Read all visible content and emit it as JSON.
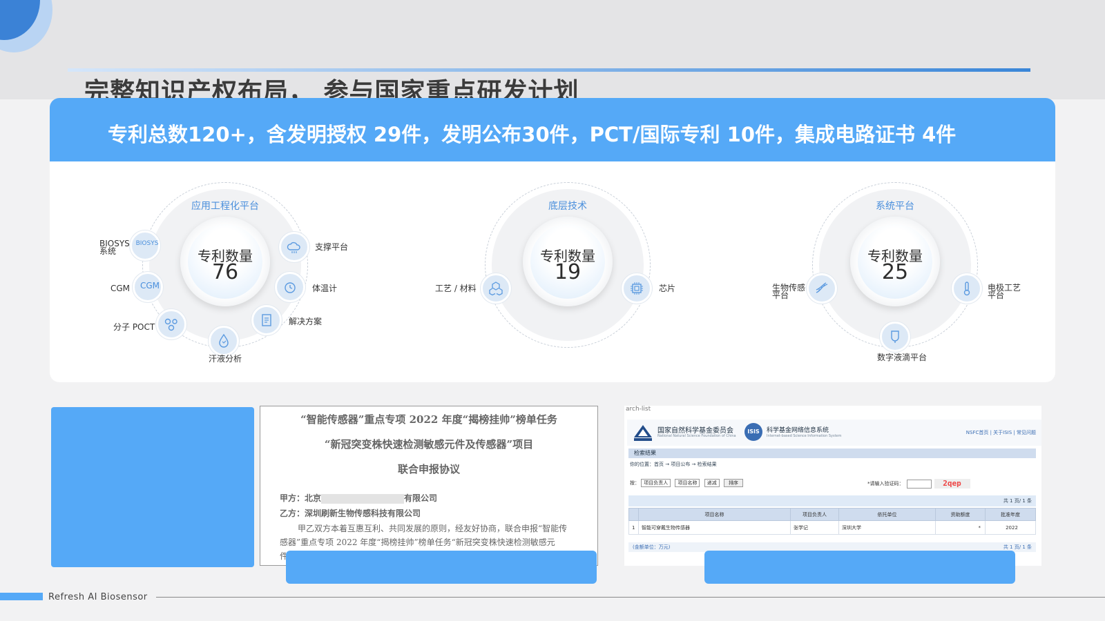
{
  "page": {
    "title": "完整知识产权布局， 参与国家重点研发计划",
    "banner": "专利总数120+，含发明授权 29件，发明公布30件，PCT/国际专利 10件，集成电路证书 4件",
    "footer": "Refresh AI Biosensor"
  },
  "clusters": [
    {
      "title": "应用工程化平台",
      "core_label": "专利数量",
      "core_value": "76",
      "nodes": [
        {
          "label": "BIOSYS系统",
          "icon_text": "BIOSYS",
          "icon": "biosys-logo-icon"
        },
        {
          "label": "CGM",
          "icon_text": "CGM",
          "icon": "cgm-logo-icon"
        },
        {
          "label": "分子 POCT",
          "icon": "molecule-icon"
        },
        {
          "label": "汗液分析",
          "icon": "droplet-icon"
        },
        {
          "label": "解决方案",
          "icon": "document-icon"
        },
        {
          "label": "体温计",
          "icon": "clock-icon"
        },
        {
          "label": "支撑平台",
          "icon": "cloud-icon"
        }
      ]
    },
    {
      "title": "底层技术",
      "core_label": "专利数量",
      "core_value": "19",
      "nodes": [
        {
          "label": "工艺 / 材料",
          "icon": "cubes-icon"
        },
        {
          "label": "芯片",
          "icon": "chip-icon"
        }
      ]
    },
    {
      "title": "系统平台",
      "core_label": "专利数量",
      "core_value": "25",
      "nodes": [
        {
          "label": "生物传感平台",
          "icon": "dna-icon"
        },
        {
          "label": "电极工艺平台",
          "icon": "thermometer-icon"
        },
        {
          "label": "数字液滴平台",
          "icon": "test-tube-icon"
        }
      ]
    }
  ],
  "agreement": {
    "line1": "“智能传感器”重点专项 2022 年度“揭榜挂帅”榜单任务",
    "line2": "“新冠突变株快速检测敏感元件及传感器”项目",
    "line3": "联合申报协议",
    "party_a_prefix": "甲方：北京",
    "party_a_suffix": "有限公司",
    "party_b": "乙方：深圳刷新生物传感科技有限公司",
    "body1": "甲乙双方本着互惠互利、共同发展的原则，经友好协商，联合申报“智能传",
    "body2": "感器”重点专项 2022 年度“揭榜挂帅”榜单任务“新冠突变株快速检测敏感元",
    "body3": "件"
  },
  "nsfc": {
    "tab": "arch-list",
    "org_name": "国家自然科学基金委员会",
    "org_name_en": "National Natural Science Foundation of China",
    "system_name": "科学基金网络信息系统",
    "system_name_en": "Internet-based Science Information System",
    "links": "NSFC首页 | 关于ISIS | 常见问题",
    "section": "检索结果",
    "breadcrumb": "你的位置：首页 → 项目公布 → 检索结果",
    "form_prefix": "按：",
    "select1": "项目负责人",
    "select2": "项目名称",
    "select3": "递减",
    "sort_button": "排序",
    "captcha_label": "*请输入验证码：",
    "captcha": "2qep",
    "pager": "共 1 页/ 1 条",
    "columns": [
      "项目名称",
      "项目负责人",
      "依托单位",
      "资助额度",
      "批准年度"
    ],
    "row": [
      "1",
      "智能可穿戴生物传感器",
      "张学记",
      "深圳大学",
      "*",
      "2022"
    ],
    "footer_left": "(金额单位：万元)",
    "footer_right": "共 1 页/ 1 条"
  }
}
